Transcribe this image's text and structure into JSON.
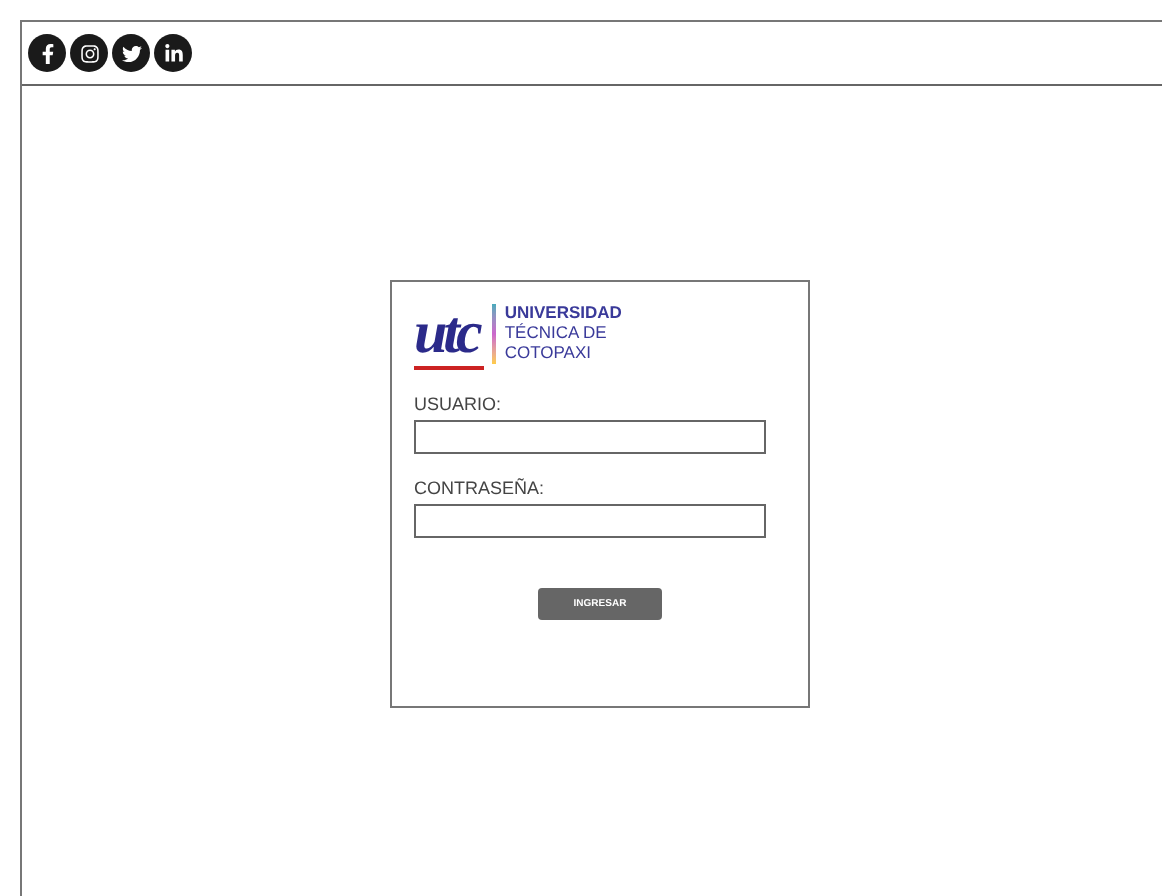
{
  "header": {
    "social_icons": [
      {
        "kind": "facebook"
      },
      {
        "kind": "instagram"
      },
      {
        "kind": "twitter"
      },
      {
        "kind": "linkedin"
      }
    ]
  },
  "login": {
    "logo_mark": "utc",
    "logo_lines": [
      "UNIVERSIDAD",
      "TÉCNICA DE",
      "COTOPAXI"
    ],
    "fields": [
      {
        "label": "USUARIO:"
      },
      {
        "label": "CONTRASEÑA:"
      }
    ],
    "button": "INGRESAR"
  }
}
